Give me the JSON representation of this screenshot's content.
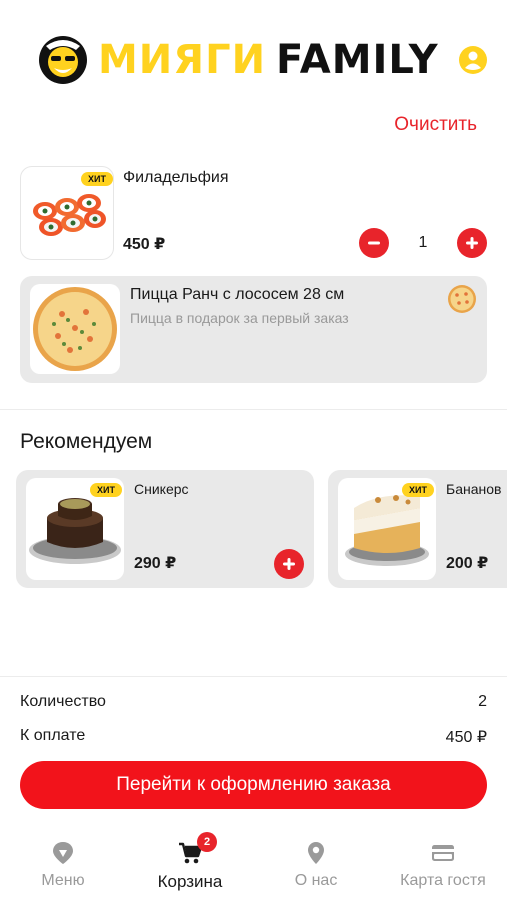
{
  "header": {
    "brand_part1": "МИЯГИ",
    "brand_part2": "FAMILY",
    "logo_icon": "mascot-logo",
    "profile_icon": "user-icon"
  },
  "cart": {
    "clear_label": "Очистить",
    "items": [
      {
        "name": "Филадельфия",
        "badge": "ХИТ",
        "price": "450 ₽",
        "quantity": "1"
      }
    ],
    "gift": {
      "title": "Пицца Ранч с лососем 28 см",
      "subtitle": "Пицца в подарок за первый заказ"
    }
  },
  "recommendations": {
    "title": "Рекомендуем",
    "items": [
      {
        "name": "Сникерс",
        "badge": "ХИТ",
        "price": "290 ₽"
      },
      {
        "name": "Бананов",
        "badge": "ХИТ",
        "price": "200 ₽"
      }
    ]
  },
  "summary": {
    "quantity_label": "Количество",
    "quantity_value": "2",
    "total_label": "К оплате",
    "total_value": "450 ₽",
    "checkout_label": "Перейти к оформлению заказа"
  },
  "tabbar": {
    "tabs": [
      {
        "label": "Меню",
        "icon": "menu-icon",
        "active": false
      },
      {
        "label": "Корзина",
        "icon": "cart-icon",
        "active": true,
        "badge": "2"
      },
      {
        "label": "О нас",
        "icon": "location-icon",
        "active": false
      },
      {
        "label": "Карта гостя",
        "icon": "card-icon",
        "active": false
      }
    ]
  },
  "colors": {
    "accent": "#E8242B",
    "brand_yellow": "#FFD21F",
    "card_bg": "#E9E9E9",
    "muted_text": "#9a9a9a"
  }
}
